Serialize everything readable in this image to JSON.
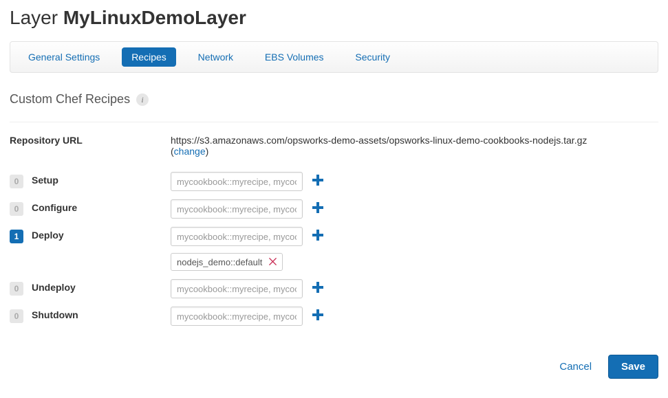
{
  "page": {
    "title_prefix": "Layer",
    "title_name": "MyLinuxDemoLayer"
  },
  "tabs": {
    "general": "General Settings",
    "recipes": "Recipes",
    "network": "Network",
    "ebs": "EBS Volumes",
    "security": "Security"
  },
  "section": {
    "title": "Custom Chef Recipes"
  },
  "repo": {
    "label": "Repository URL",
    "url": "https://s3.amazonaws.com/opsworks-demo-assets/opsworks-linux-demo-cookbooks-nodejs.tar.gz",
    "change": "change"
  },
  "recipe_placeholder": "mycookbook::myrecipe, mycookbook",
  "events": {
    "setup": {
      "label": "Setup",
      "count": "0",
      "chips": []
    },
    "configure": {
      "label": "Configure",
      "count": "0",
      "chips": []
    },
    "deploy": {
      "label": "Deploy",
      "count": "1",
      "chips": [
        "nodejs_demo::default"
      ]
    },
    "undeploy": {
      "label": "Undeploy",
      "count": "0",
      "chips": []
    },
    "shutdown": {
      "label": "Shutdown",
      "count": "0",
      "chips": []
    }
  },
  "footer": {
    "cancel": "Cancel",
    "save": "Save"
  }
}
